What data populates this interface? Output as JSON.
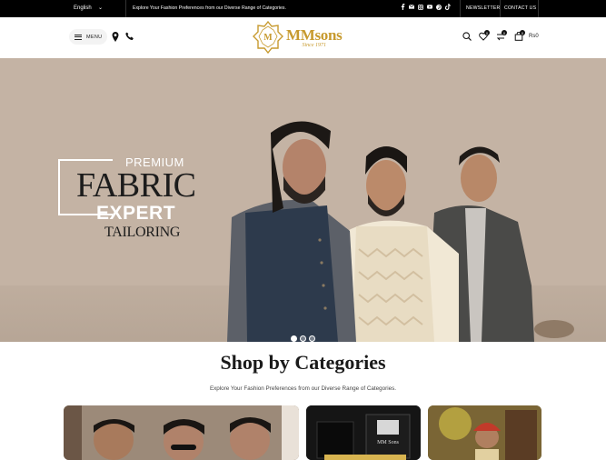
{
  "topbar": {
    "language": "English",
    "tagline": "Explore Your Fashion Preferences from our Diverse Range of Categories.",
    "socials": [
      "facebook-icon",
      "mail-icon",
      "instagram-icon",
      "youtube-icon",
      "pinterest-icon",
      "tiktok-icon"
    ],
    "newsletter": "NEWSLETTER",
    "contact": "CONTACT US"
  },
  "header": {
    "menu_label": "MENU",
    "logo_name": "MMsons",
    "logo_since": "Since 1971",
    "wishlist_count": "0",
    "compare_count": "0",
    "cart_count": "0",
    "cart_amount": "Rs0"
  },
  "hero": {
    "premium": "PREMIUM",
    "fabric": "FABRIC",
    "expert": "EXPERT",
    "tailoring": "TAILORING",
    "slides": 3,
    "active_slide": 1
  },
  "categories": {
    "title": "Shop by Categories",
    "subtitle": "Explore Your Fashion Preferences from our Diverse Range of Categories."
  },
  "colors": {
    "topbar": "#000000",
    "brand_gold": "#c79a2e"
  }
}
